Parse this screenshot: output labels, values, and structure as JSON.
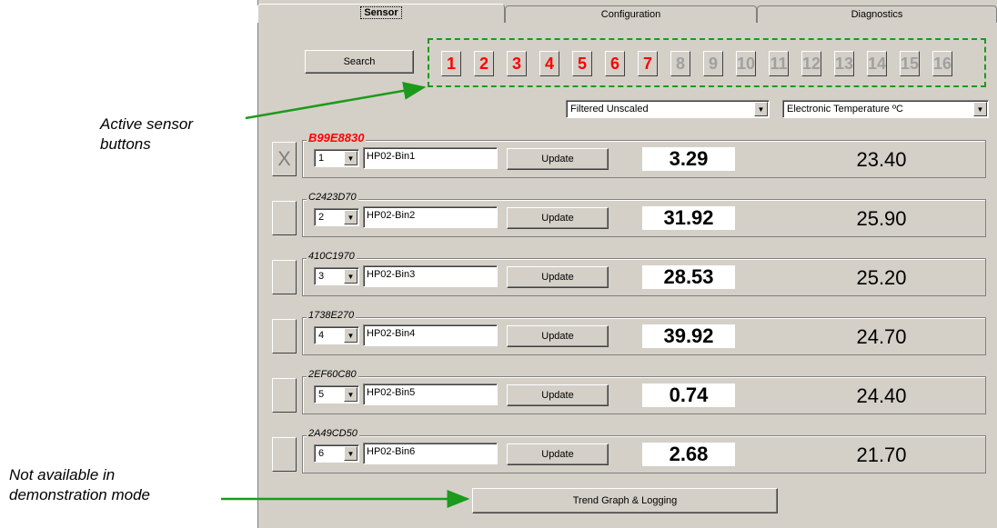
{
  "tabs": [
    "Sensor",
    "Configuration",
    "Diagnostics"
  ],
  "search_label": "Search",
  "sensor_buttons": {
    "active": [
      "1",
      "2",
      "3",
      "4",
      "5",
      "6",
      "7"
    ],
    "inactive": [
      "8",
      "9",
      "10",
      "11",
      "12",
      "13",
      "14",
      "15",
      "16"
    ]
  },
  "mode_select": "Filtered Unscaled",
  "temp_select": "Electronic Temperature ºC",
  "sensors": [
    {
      "serial": "B99E8830",
      "side": "X",
      "index": "1",
      "name": "HP02-Bin1",
      "update": "Update",
      "value": "3.29",
      "temp": "23.40"
    },
    {
      "serial": "C2423D70",
      "side": "",
      "index": "2",
      "name": "HP02-Bin2",
      "update": "Update",
      "value": "31.92",
      "temp": "25.90"
    },
    {
      "serial": "410C1970",
      "side": "",
      "index": "3",
      "name": "HP02-Bin3",
      "update": "Update",
      "value": "28.53",
      "temp": "25.20"
    },
    {
      "serial": "1738E270",
      "side": "",
      "index": "4",
      "name": "HP02-Bin4",
      "update": "Update",
      "value": "39.92",
      "temp": "24.70"
    },
    {
      "serial": "2EF60C80",
      "side": "",
      "index": "5",
      "name": "HP02-Bin5",
      "update": "Update",
      "value": "0.74",
      "temp": "24.40"
    },
    {
      "serial": "2A49CD50",
      "side": "",
      "index": "6",
      "name": "HP02-Bin6",
      "update": "Update",
      "value": "2.68",
      "temp": "21.70"
    }
  ],
  "trend_label": "Trend Graph  & Logging",
  "annotations": {
    "active_line1": "Active sensor",
    "active_line2": "buttons",
    "na_line1": "Not available in",
    "na_line2": "demonstration mode"
  },
  "colors": {
    "panel": "#d4d0c8",
    "active_red": "#ff0000",
    "arrow_green": "#1c9a1c"
  }
}
